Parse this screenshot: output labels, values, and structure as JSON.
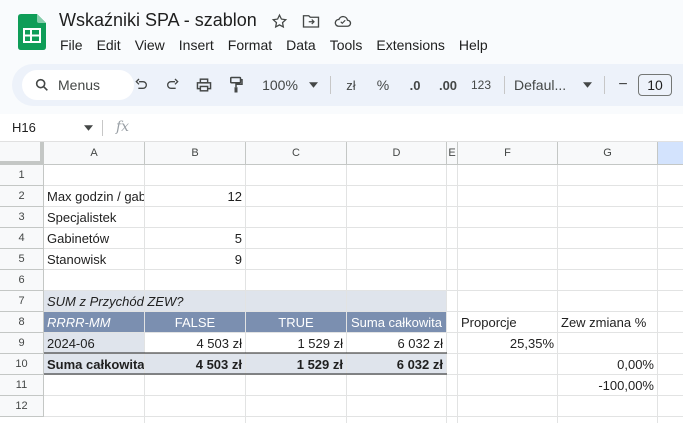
{
  "doc": {
    "title": "Wskaźniki SPA - szablon",
    "menu": [
      "File",
      "Edit",
      "View",
      "Insert",
      "Format",
      "Data",
      "Tools",
      "Extensions",
      "Help"
    ]
  },
  "toolbar": {
    "search_label": "Menus",
    "zoom": "100%",
    "currency": "zł",
    "percent": "%",
    "dec_decrease": ".0",
    "dec_increase": ".00",
    "number_format": "123",
    "font": "Defaul...",
    "font_minus": "−",
    "font_size": "10"
  },
  "formula_bar": {
    "cell_ref": "H16",
    "fx": "fx"
  },
  "columns": [
    "A",
    "B",
    "C",
    "D",
    "E",
    "F",
    "G"
  ],
  "rows": [
    "1",
    "2",
    "3",
    "4",
    "5",
    "6",
    "7",
    "8",
    "9",
    "10",
    "11",
    "12"
  ],
  "cells": {
    "A2": "Max godzin / gab",
    "B2": "12",
    "A3": "Specjalistek",
    "A4": "Gabinetów",
    "B4": "5",
    "A5": "Stanowisk",
    "B5": "9",
    "A7": "SUM z Przychód ZEW?",
    "A8": "RRRR-MM",
    "B8": "FALSE",
    "C8": "TRUE",
    "D8": "Suma całkowita",
    "F8": "Proporcje",
    "G8": "Zew zmiana %",
    "A9": "2024-06",
    "B9": "4 503 zł",
    "C9": "1 529 zł",
    "D9": "6 032 zł",
    "F9": "25,35%",
    "A10": "Suma całkowita",
    "B10": "4 503 zł",
    "C10": "1 529 zł",
    "D10": "6 032 zł",
    "G10": "0,00%",
    "G11": "-100,00%"
  },
  "colors": {
    "pivot_header": "#7b8fb0",
    "pivot_light": "#dfe4ec",
    "sheets_green": "#0f9d58"
  }
}
